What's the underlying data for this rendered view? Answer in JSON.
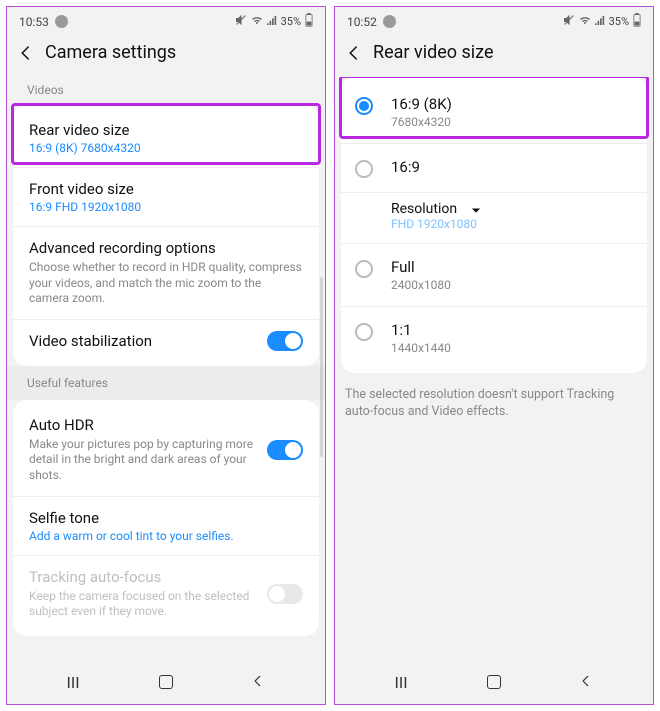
{
  "left": {
    "status": {
      "time": "10:53",
      "battery": "35%"
    },
    "header": {
      "title": "Camera settings"
    },
    "sections": {
      "videos": "Videos",
      "useful": "Useful features"
    },
    "rows": {
      "rear": {
        "title": "Rear video size",
        "sub": "16:9 (8K) 7680x4320"
      },
      "front": {
        "title": "Front video size",
        "sub": "16:9 FHD 1920x1080"
      },
      "adv": {
        "title": "Advanced recording options",
        "desc": "Choose whether to record in HDR quality, compress your videos, and match the mic zoom to the camera zoom."
      },
      "stab": {
        "title": "Video stabilization"
      },
      "hdr": {
        "title": "Auto HDR",
        "desc": "Make your pictures pop by capturing more detail in the bright and dark areas of your shots."
      },
      "selfie": {
        "title": "Selfie tone",
        "sub": "Add a warm or cool tint to your selfies."
      },
      "track": {
        "title": "Tracking auto-focus",
        "desc": "Keep the camera focused on the selected subject even if they move."
      }
    }
  },
  "right": {
    "status": {
      "time": "10:52",
      "battery": "35%"
    },
    "header": {
      "title": "Rear video size"
    },
    "options": [
      {
        "title": "16:9 (8K)",
        "sub": "7680x4320",
        "selected": true
      },
      {
        "title": "16:9",
        "sub": ""
      },
      {
        "title": "Full",
        "sub": "2400x1080"
      },
      {
        "title": "1:1",
        "sub": "1440x1440"
      }
    ],
    "resolution": {
      "label": "Resolution",
      "value": "FHD 1920x1080"
    },
    "note": "The selected resolution doesn't support Tracking auto-focus and Video effects."
  }
}
